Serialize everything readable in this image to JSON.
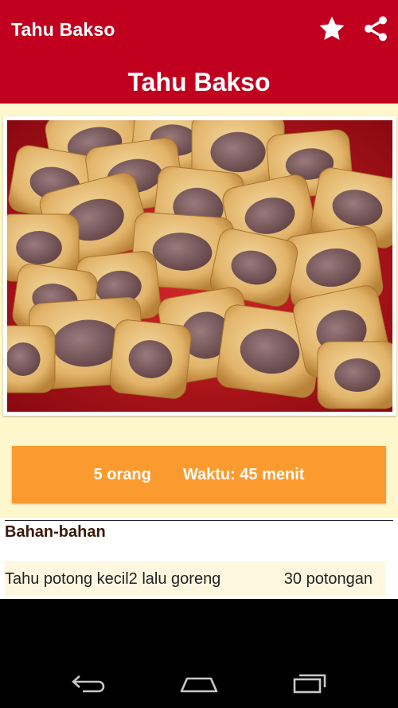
{
  "action_bar": {
    "title": "Tahu Bakso",
    "icons": [
      "star-icon",
      "share-icon"
    ]
  },
  "recipe": {
    "title": "Tahu Bakso",
    "servings": "5 orang",
    "time": "Waktu: 45 menit"
  },
  "ingredients": {
    "heading": "Bahan-bahan",
    "items": [
      {
        "name": "Tahu potong kecil2 lalu goreng",
        "qty": "30 potongan"
      }
    ]
  },
  "nav": {
    "icons": [
      "back-icon",
      "home-icon",
      "recents-icon"
    ]
  },
  "colors": {
    "primary": "#c0001e",
    "accent": "#fb9a2e",
    "background": "#fef7cc"
  }
}
